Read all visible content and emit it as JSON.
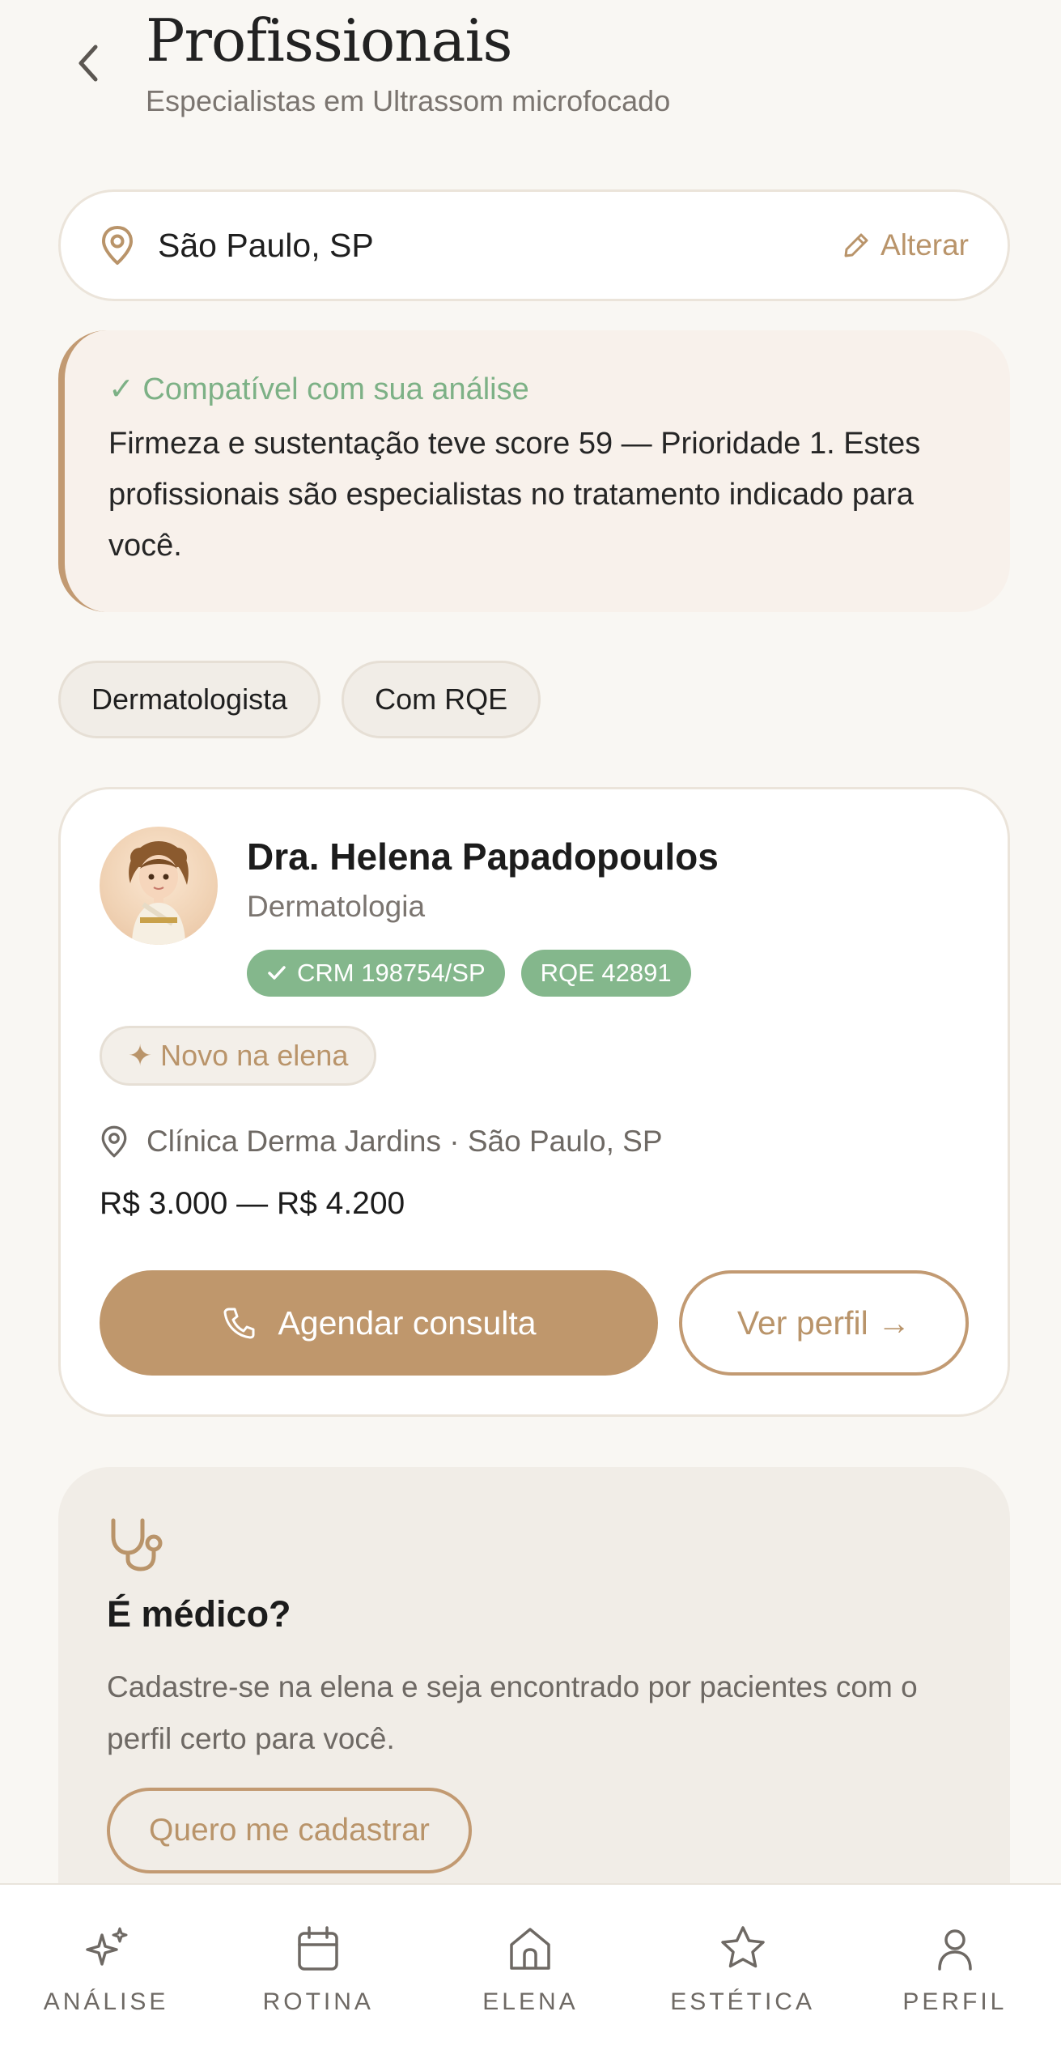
{
  "header": {
    "title": "Profissionais",
    "subtitle": "Especialistas em Ultrassom microfocado"
  },
  "location": {
    "city": "São Paulo, SP",
    "edit_label": "Alterar"
  },
  "compat": {
    "head": "✓ Compatível com sua análise",
    "body": "Firmeza e sustentação teve score 59 — Prioridade 1. Estes profissionais são especialistas no tratamento indicado para você."
  },
  "filters": {
    "chips": [
      "Dermatologista",
      "Com RQE"
    ]
  },
  "professional": {
    "name": "Dra. Helena Papadopoulos",
    "specialty": "Dermatologia",
    "crm": "CRM 198754/SP",
    "rqe": "RQE 42891",
    "new_tag": "✦ Novo na elena",
    "clinic": "Clínica Derma Jardins · São Paulo, SP",
    "price": "R$ 3.000 — R$ 4.200",
    "schedule_label": "Agendar consulta",
    "profile_label": "Ver perfil →"
  },
  "doctor_cta": {
    "title": "É médico?",
    "text": "Cadastre-se na elena e seja encontrado por pacientes com o perfil certo para você.",
    "button": "Quero me cadastrar"
  },
  "nav": {
    "items": [
      {
        "label": "ANÁLISE",
        "icon": "sparkles-icon"
      },
      {
        "label": "ROTINA",
        "icon": "calendar-icon"
      },
      {
        "label": "ELENA",
        "icon": "home-icon"
      },
      {
        "label": "ESTÉTICA",
        "icon": "star-icon"
      },
      {
        "label": "PERFIL",
        "icon": "user-icon"
      }
    ]
  },
  "colors": {
    "accent": "#bf976c",
    "accent_text": "#b9946a",
    "success": "#84b78c",
    "background": "#f9f7f3"
  }
}
